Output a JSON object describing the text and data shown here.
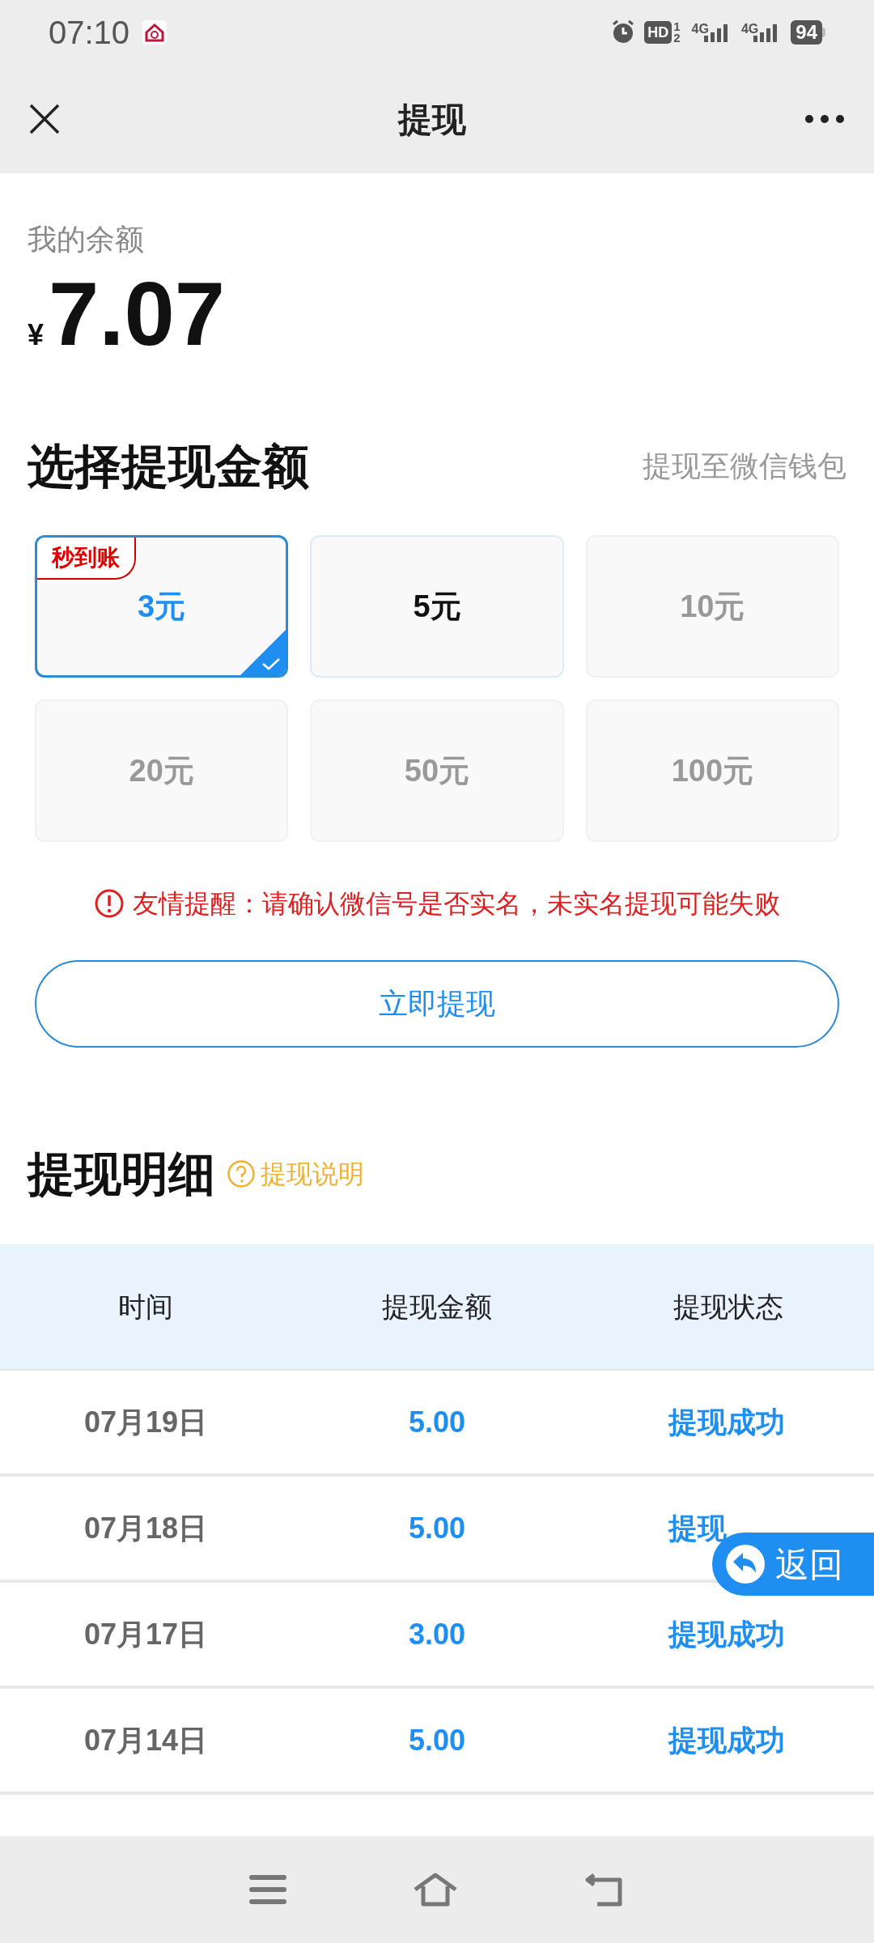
{
  "status_bar": {
    "time": "07:10",
    "hd": "HD",
    "hd_slots": [
      "1",
      "2"
    ],
    "networks": [
      "4G",
      "4G"
    ],
    "battery": "94"
  },
  "header": {
    "title": "提现"
  },
  "balance": {
    "label": "我的余额",
    "currency": "¥",
    "amount": "7.07"
  },
  "amount_section": {
    "title": "选择提现金额",
    "destination": "提现至微信钱包",
    "options": [
      {
        "label": "3元",
        "badge": "秒到账",
        "selected": true,
        "disabled": false
      },
      {
        "label": "5元",
        "selected": false,
        "disabled": false
      },
      {
        "label": "10元",
        "selected": false,
        "disabled": true
      },
      {
        "label": "20元",
        "selected": false,
        "disabled": true
      },
      {
        "label": "50元",
        "selected": false,
        "disabled": true
      },
      {
        "label": "100元",
        "selected": false,
        "disabled": true
      }
    ]
  },
  "warning": "友情提醒：请确认微信号是否实名，未实名提现可能失败",
  "submit_button": "立即提现",
  "history": {
    "title": "提现明细",
    "help_link": "提现说明",
    "columns": [
      "时间",
      "提现金额",
      "提现状态"
    ],
    "rows": [
      {
        "date": "07月19日",
        "amount": "5.00",
        "status": "提现成功"
      },
      {
        "date": "07月18日",
        "amount": "5.00",
        "status": "提现"
      },
      {
        "date": "07月17日",
        "amount": "3.00",
        "status": "提现成功"
      },
      {
        "date": "07月14日",
        "amount": "5.00",
        "status": "提现成功"
      }
    ]
  },
  "float_button": "返回"
}
